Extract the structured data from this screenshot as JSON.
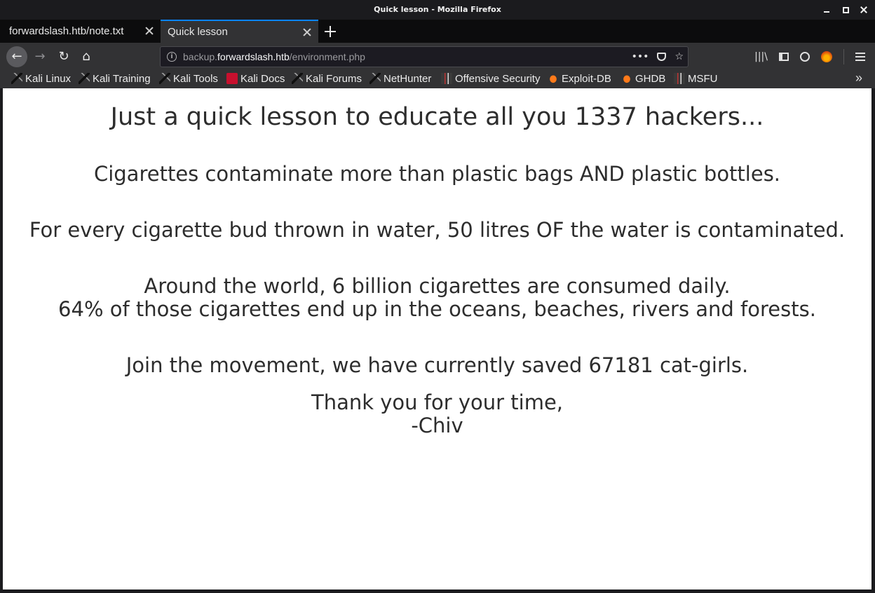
{
  "window": {
    "title": "Quick lesson - Mozilla Firefox"
  },
  "tabs": [
    {
      "label": "forwardslash.htb/note.txt",
      "active": false
    },
    {
      "label": "Quick lesson",
      "active": true
    }
  ],
  "urlbar": {
    "prefix": "backup.",
    "domain": "forwardslash.htb",
    "path": "/environment.php"
  },
  "bookmarks": [
    {
      "label": "Kali Linux",
      "icon": "kali-dragon-icon"
    },
    {
      "label": "Kali Training",
      "icon": "kali-dragon-icon"
    },
    {
      "label": "Kali Tools",
      "icon": "kali-dragon-icon"
    },
    {
      "label": "Kali Docs",
      "icon": "kali-docs-icon"
    },
    {
      "label": "Kali Forums",
      "icon": "kali-dragon-icon"
    },
    {
      "label": "NetHunter",
      "icon": "kali-dragon-icon"
    },
    {
      "label": "Offensive Security",
      "icon": "offsec-icon"
    },
    {
      "label": "Exploit-DB",
      "icon": "exploit-db-icon"
    },
    {
      "label": "GHDB",
      "icon": "exploit-db-icon"
    },
    {
      "label": "MSFU",
      "icon": "offsec-icon"
    }
  ],
  "page": {
    "heading": "Just a quick lesson to educate all you 1337 hackers...",
    "lines": [
      "Cigarettes contaminate more than plastic bags AND plastic bottles.",
      "For every cigarette bud thrown in water, 50 litres OF the water is contaminated.",
      "Around the world, 6 billion cigarettes are consumed daily.",
      "64% of those cigarettes end up in the oceans, beaches, rivers and forests.",
      "Join the movement, we have currently saved 67181 cat-girls.",
      "Thank you for your time,",
      "-Chiv"
    ]
  },
  "colors": {
    "accent": "#0a84ff",
    "toolbar": "#323234",
    "tabstrip": "#0c0c0d"
  }
}
